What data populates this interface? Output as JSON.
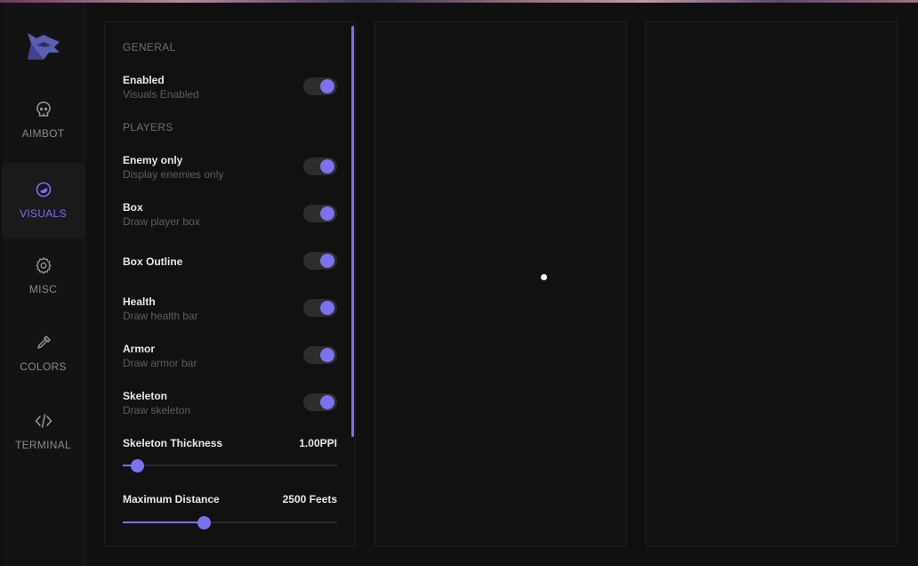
{
  "sidebar": {
    "logo": "wolf-logo",
    "items": [
      {
        "label": "AIMBOT",
        "icon": "skull-icon",
        "active": false
      },
      {
        "label": "VISUALS",
        "icon": "eye-icon",
        "active": true
      },
      {
        "label": "MISC",
        "icon": "gear-icon",
        "active": false
      },
      {
        "label": "COLORS",
        "icon": "eyedropper-icon",
        "active": false
      },
      {
        "label": "TERMINAL",
        "icon": "code-icon",
        "active": false
      }
    ]
  },
  "visuals": {
    "general_title": "GENERAL",
    "players_title": "PLAYERS",
    "toggles": [
      {
        "title": "Enabled",
        "subtitle": "Visuals Enabled",
        "on": true
      },
      {
        "title": "Enemy only",
        "subtitle": "Display enemies only",
        "on": true
      },
      {
        "title": "Box",
        "subtitle": "Draw player box",
        "on": true
      },
      {
        "title": "Box Outline",
        "subtitle": "",
        "on": true
      },
      {
        "title": "Health",
        "subtitle": "Draw health bar",
        "on": true
      },
      {
        "title": "Armor",
        "subtitle": "Draw armor bar",
        "on": true
      },
      {
        "title": "Skeleton",
        "subtitle": "Draw skeleton",
        "on": true
      }
    ],
    "sliders": [
      {
        "title": "Skeleton Thickness",
        "value": "1.00PPI",
        "level": 0.07
      },
      {
        "title": "Maximum Distance",
        "value": "2500 Feets",
        "level": 0.38
      }
    ]
  },
  "colors": {
    "accent": "#7b72f0",
    "background": "#101010",
    "panel": "#111111"
  }
}
